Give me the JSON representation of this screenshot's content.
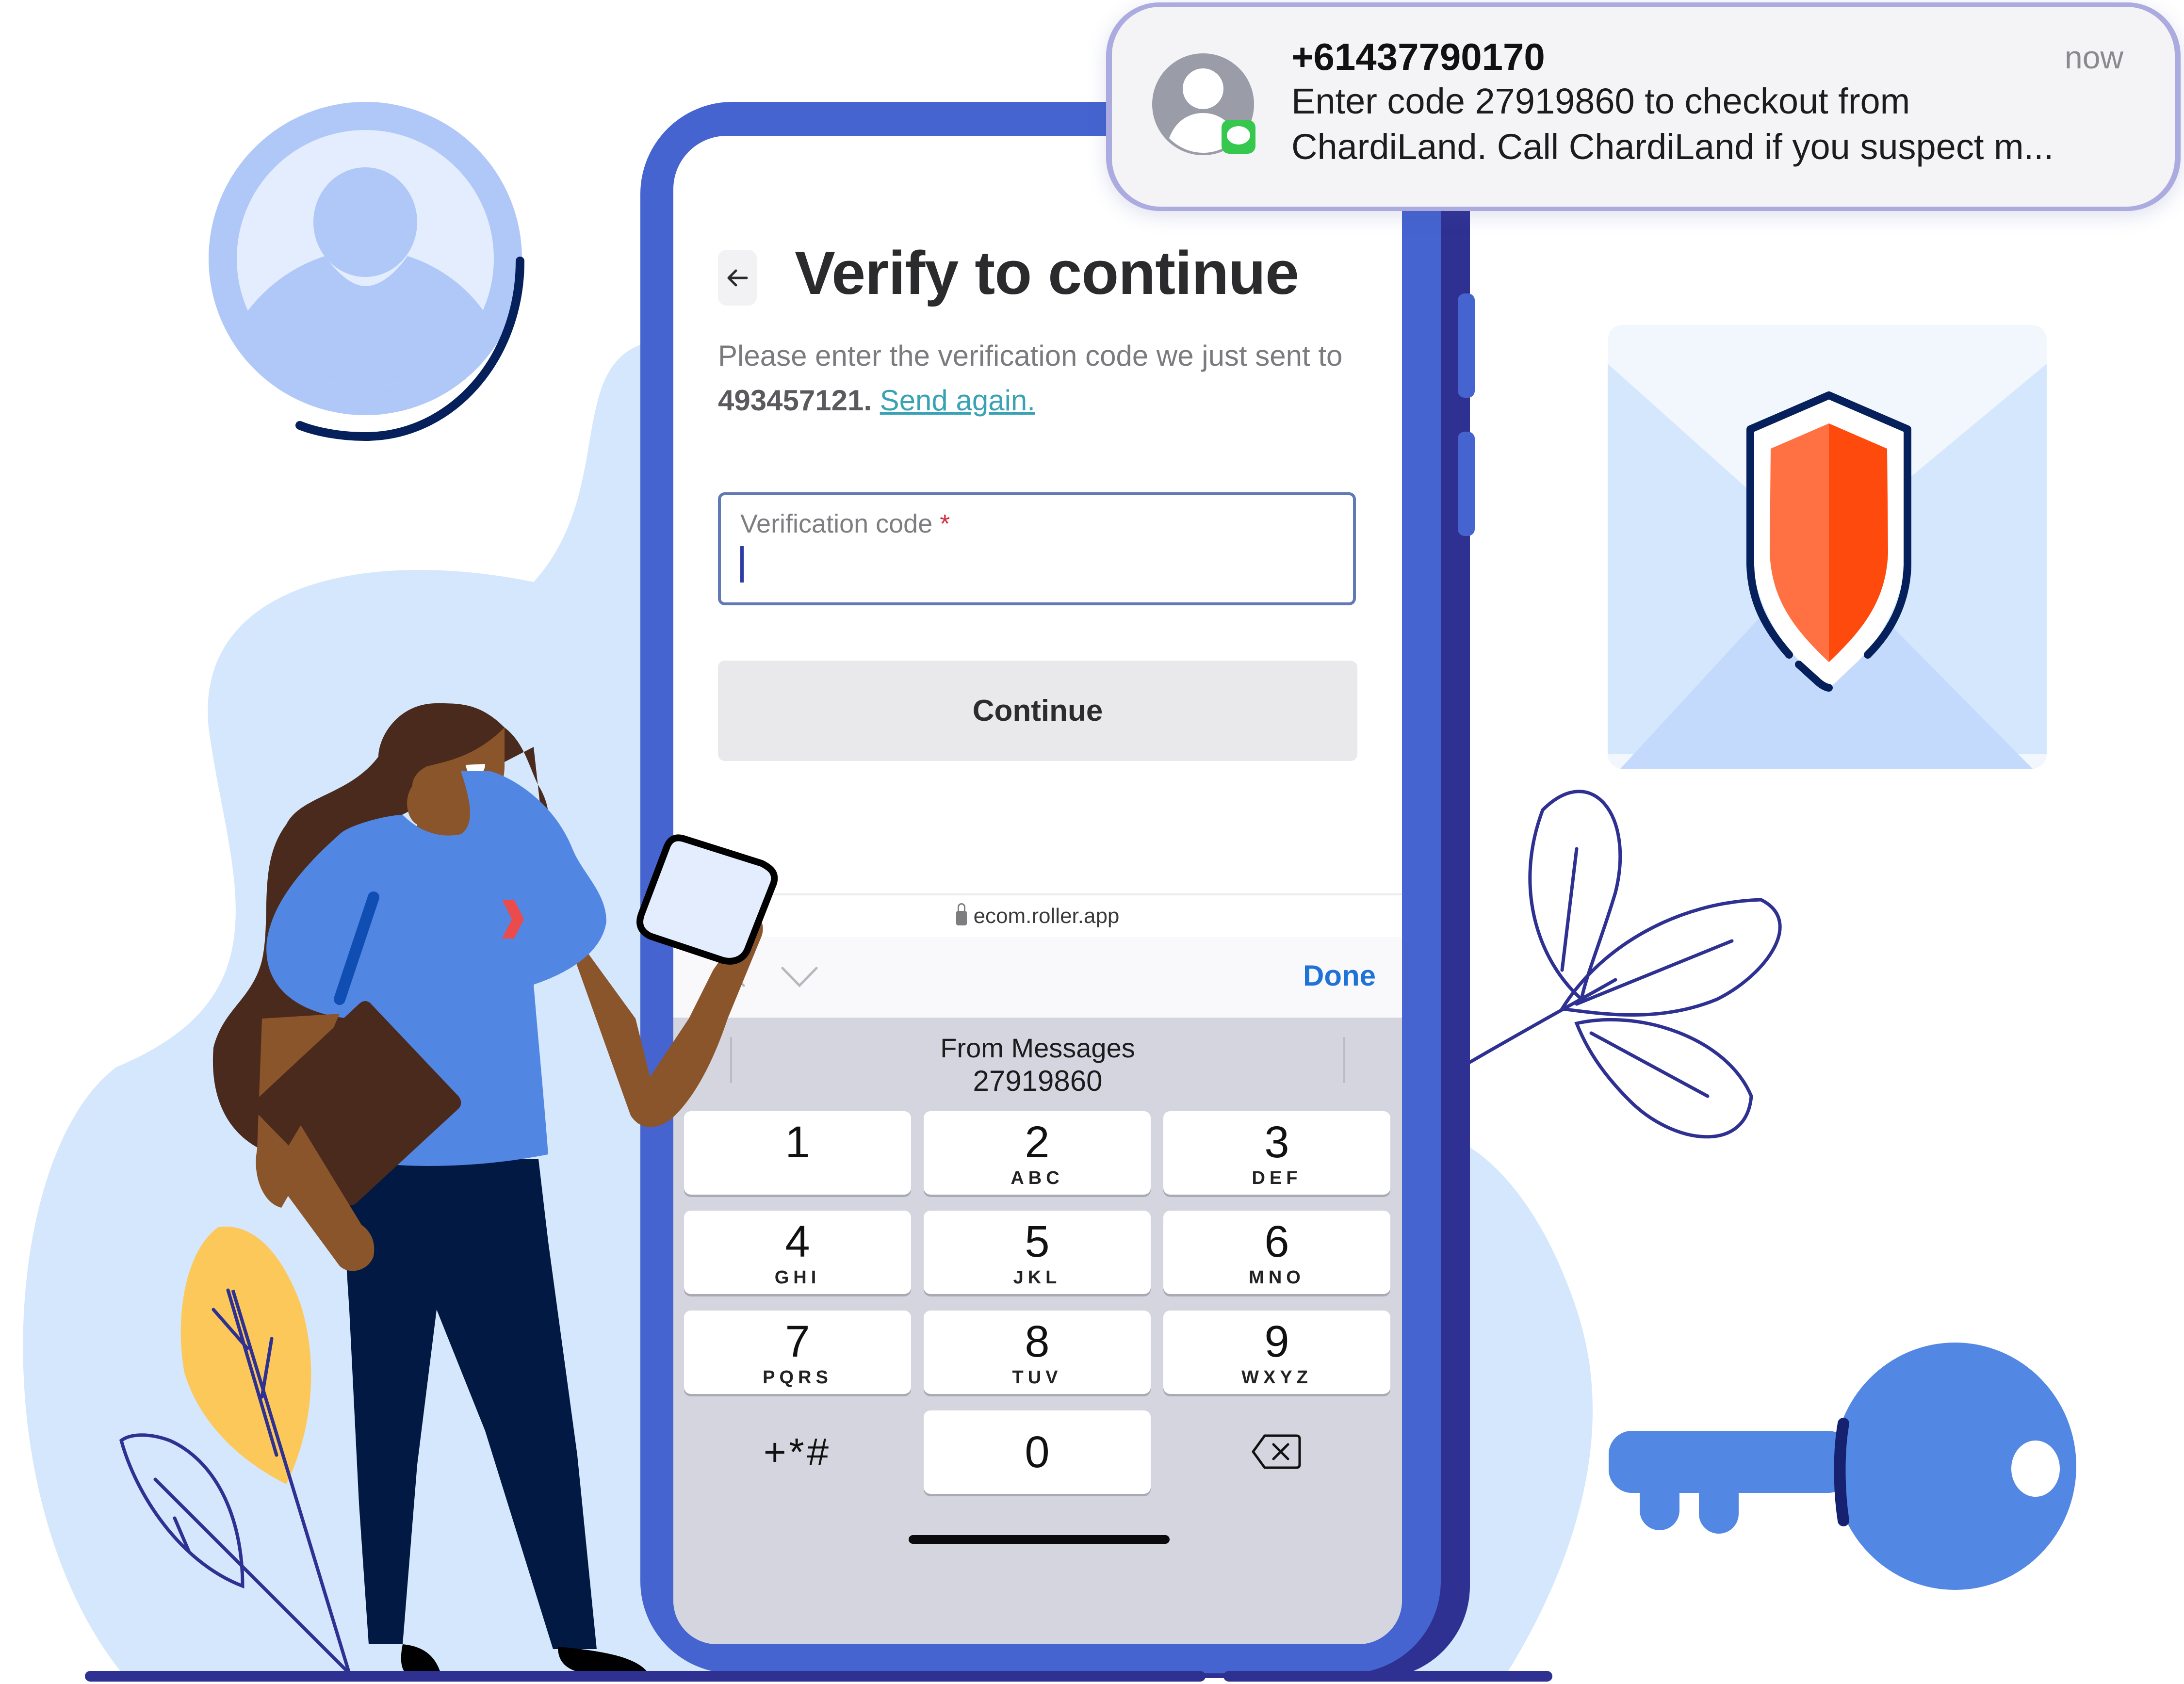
{
  "notification": {
    "sender": "+61437790170",
    "time": "now",
    "message_line1": "Enter code 27919860 to checkout from",
    "message_line2": "ChardiLand. Call ChardiLand if you suspect m...",
    "app_icon": "messages-icon",
    "avatar_icon": "contact-placeholder-icon"
  },
  "page": {
    "back_icon": "arrow-left-icon",
    "title": "Verify to continue",
    "instructions_prefix": "Please enter the verification code we just sent to ",
    "phone_number": "493457121.",
    "send_again": "Send again."
  },
  "form": {
    "code_label": "Verification code",
    "required_marker": "*",
    "code_value": "",
    "continue_label": "Continue"
  },
  "browser": {
    "url": "ecom.roller.app",
    "lock_icon": "lock-icon"
  },
  "keyboard_toolbar": {
    "prev_icon": "chevron-up-icon",
    "next_icon": "chevron-down-icon",
    "done_label": "Done"
  },
  "keyboard": {
    "suggestion_title": "From Messages",
    "suggestion_code": "27919860",
    "keys": [
      {
        "num": "1",
        "letters": ""
      },
      {
        "num": "2",
        "letters": "ABC"
      },
      {
        "num": "3",
        "letters": "DEF"
      },
      {
        "num": "4",
        "letters": "GHI"
      },
      {
        "num": "5",
        "letters": "JKL"
      },
      {
        "num": "6",
        "letters": "MNO"
      },
      {
        "num": "7",
        "letters": "PQRS"
      },
      {
        "num": "8",
        "letters": "TUV"
      },
      {
        "num": "9",
        "letters": "WXYZ"
      },
      {
        "num": "0",
        "letters": ""
      }
    ],
    "symbols_label": "+*#",
    "delete_icon": "backspace-icon"
  },
  "colors": {
    "phone_frame": "#4564cf",
    "phone_shadow": "#2e3192",
    "link": "#3aa2b5",
    "done": "#1f73d6",
    "input_border": "#6179b5",
    "shield_left": "#ff7142",
    "shield_right": "#ff4a0e",
    "key_blue": "#5288e3",
    "bg_blob": "#d4e7fd"
  }
}
